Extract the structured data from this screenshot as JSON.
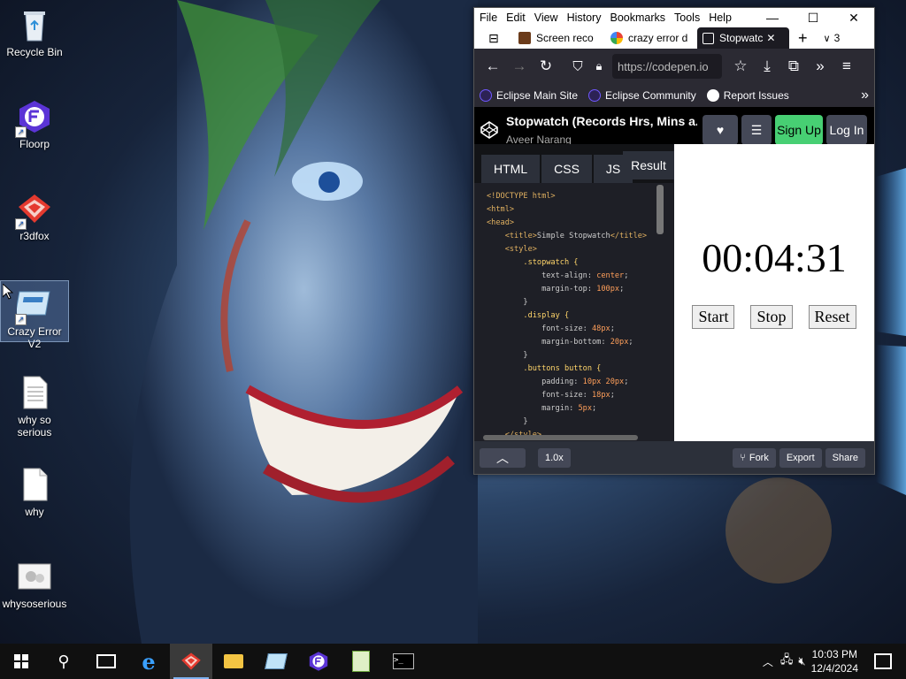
{
  "desktop": {
    "icons": [
      {
        "label": "Recycle Bin"
      },
      {
        "label": "Floorp"
      },
      {
        "label": "r3dfox"
      },
      {
        "label": "Crazy Error V2"
      },
      {
        "label": "why so serious"
      },
      {
        "label": "why"
      },
      {
        "label": "whysoserious"
      }
    ]
  },
  "browser": {
    "menu": [
      "File",
      "Edit",
      "View",
      "History",
      "Bookmarks",
      "Tools",
      "Help"
    ],
    "tabs": [
      {
        "label": "Screen reco"
      },
      {
        "label": "crazy error d"
      },
      {
        "label": "Stopwatc"
      }
    ],
    "tab_count": "3",
    "url": "https://codepen.io",
    "bookmarks": [
      "Eclipse Main Site",
      "Eclipse Community",
      "Report Issues"
    ],
    "codepen": {
      "title": "Stopwatch (Records Hrs, Mins a...",
      "author": "Aveer Narang",
      "signup_label": "Sign Up",
      "login_label": "Log In",
      "editor_tabs": [
        "HTML",
        "CSS",
        "JS"
      ],
      "result_tab": "Result",
      "code_lines": [
        "<!DOCTYPE html>",
        "<html>",
        "<head>",
        "    <title>Simple Stopwatch</title>",
        "    <style>",
        "        .stopwatch {",
        "            text-align: center;",
        "            margin-top: 100px;",
        "        }",
        "        .display {",
        "            font-size: 48px;",
        "            margin-bottom: 20px;",
        "        }",
        "        .buttons button {",
        "            padding: 10px 20px;",
        "            font-size: 18px;",
        "            margin: 5px;",
        "        }",
        "    </style>"
      ],
      "stopwatch": {
        "display": "00:04:31",
        "start_label": "Start",
        "stop_label": "Stop",
        "reset_label": "Reset"
      },
      "footer": {
        "zoom": "1.0x",
        "fork_label": "Fork",
        "export_label": "Export",
        "share_label": "Share"
      }
    }
  },
  "taskbar": {
    "time": "10:03 PM",
    "date": "12/4/2024"
  },
  "colors": {
    "signup": "#47cf73",
    "codepen_bg": "#1e1f26",
    "taskbar": "#101010"
  }
}
